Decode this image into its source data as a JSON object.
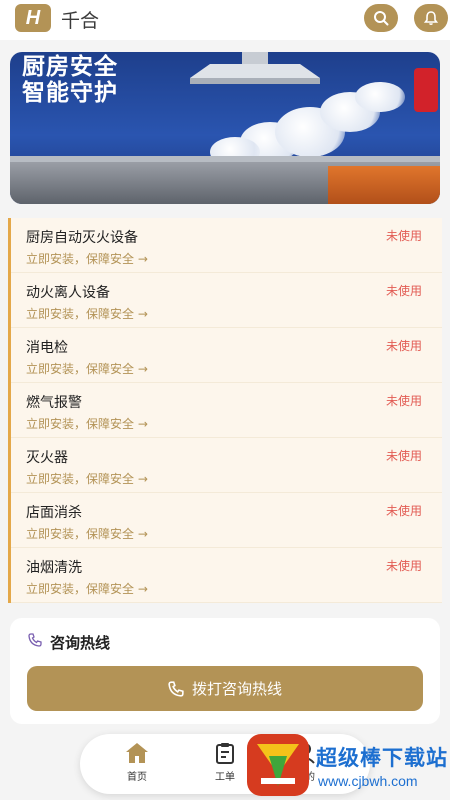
{
  "header": {
    "logo_letter": "H",
    "app_name": "千合",
    "accent_color": "#b39356"
  },
  "banner": {
    "line1": "厨房安全",
    "line2": "智能守护",
    "slide_count": 4,
    "active_slide": 1
  },
  "equipment": {
    "items": [
      {
        "name": "厨房自动灭火设备",
        "status": "未使用",
        "link": "立即安装，保障安全 →"
      },
      {
        "name": "动火离人设备",
        "status": "未使用",
        "link": "立即安装，保障安全 →"
      },
      {
        "name": "消电检",
        "status": "未使用",
        "link": "立即安装，保障安全 →"
      },
      {
        "name": "燃气报警",
        "status": "未使用",
        "link": "立即安装，保障安全 →"
      },
      {
        "name": "灭火器",
        "status": "未使用",
        "link": "立即安装，保障安全 →"
      },
      {
        "name": "店面消杀",
        "status": "未使用",
        "link": "立即安装，保障安全 →"
      },
      {
        "name": "油烟清洗",
        "status": "未使用",
        "link": "立即安装，保障安全 →"
      }
    ],
    "status_color": "#e25b53",
    "border_color": "#e4a84a"
  },
  "hotline": {
    "title": "咨询热线",
    "button_label": "拨打咨询热线"
  },
  "nav": {
    "home": "首页",
    "orders": "工单",
    "mine_partial": "我的"
  },
  "watermark": {
    "text": "超级棒下载站",
    "url": "www.cjbwh.com"
  }
}
